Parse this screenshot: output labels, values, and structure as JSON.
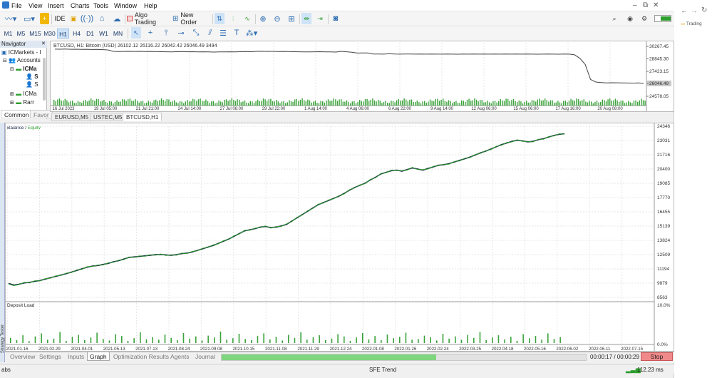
{
  "menu": [
    "File",
    "View",
    "Insert",
    "Charts",
    "Tools",
    "Window",
    "Help"
  ],
  "toolbar": {
    "ide_label": "IDE",
    "algo_label": "Algo Trading",
    "new_order_label": "New Order"
  },
  "timeframes": [
    "M1",
    "M5",
    "M15",
    "M30",
    "H1",
    "H4",
    "D1",
    "W1",
    "MN"
  ],
  "active_timeframe": "H1",
  "navigator": {
    "title": "Navigator",
    "broker": "ICMarkets - I",
    "accounts": "Accounts",
    "account1": "ICMa",
    "row_s1": "S",
    "row_s2": "S",
    "account2": "ICMa",
    "raw": "Rarr",
    "tabs": [
      "Common",
      "Favor"
    ]
  },
  "top_chart": {
    "info": "BTCUSD, H1:  Bitcoin (USD)  26102.12 26116.22 26042.42 26046.49  3494",
    "y_labels": [
      "30267.45",
      "28845.30",
      "27423.15",
      "26046.49",
      "24578.05"
    ],
    "x_labels": [
      "16 Jul 2023",
      "19 Jul 05:00",
      "21 Jul 21:00",
      "24 Jul 14:00",
      "27 Jul 06:00",
      "29 Jul 22:00",
      "1 Aug 14:00",
      "4 Aug 06:00",
      "6 Aug 22:00",
      "9 Aug 14:00",
      "12 Aug 06:00",
      "15 Aug 06:00",
      "17 Aug 16:00",
      "20 Aug 08:00"
    ],
    "price_series": [
      29950,
      29940,
      29960,
      29930,
      29945,
      29920,
      29935,
      29910,
      29920,
      29890,
      29860,
      29700,
      29680,
      29690,
      29700,
      29690,
      29700,
      29680,
      29690,
      29670,
      29660,
      29650,
      29640,
      29660,
      29670,
      29650,
      29660,
      29640,
      29650,
      29630,
      29620,
      29640,
      29630,
      29650,
      29640,
      29660,
      29670,
      29660,
      29700,
      29710,
      29690,
      29700,
      29680,
      29690,
      29670,
      29660,
      29650,
      29640,
      29630,
      29650,
      29660,
      29640,
      29630,
      29620,
      29700,
      29650,
      29600,
      29500,
      29520,
      29510,
      29400,
      29400,
      29380,
      29420,
      29390,
      29380,
      29400,
      29390,
      29380,
      29390,
      29380,
      29390,
      29380,
      29380,
      29390,
      29380,
      29370,
      29390,
      29380,
      29390,
      29380,
      29390,
      29380,
      29390,
      29380,
      29400,
      29380,
      29390,
      29380,
      29390,
      29380,
      29370,
      29380,
      29390,
      29380,
      29370,
      29390,
      29380,
      29300,
      28900,
      28200,
      26500,
      26200,
      26150,
      26100,
      26120,
      26110,
      26100,
      26090,
      26080,
      26100,
      26046
    ]
  },
  "chart_tabs": [
    "EURUSD,M5",
    "USTEC,M5",
    "BTCUSD,H1"
  ],
  "active_chart_tab": "BTCUSD,H1",
  "tester": {
    "legend_balance": "Balance",
    "legend_sep": " / ",
    "legend_equity": "Equity",
    "deposit_label": "Deposit Load",
    "y_labels": [
      "24346",
      "23031",
      "21716",
      "20400",
      "19085",
      "17770",
      "16455",
      "15139",
      "13824",
      "12509",
      "11194",
      "9879",
      "8563"
    ],
    "load_labels": [
      "10.0%",
      "0.0%"
    ],
    "x_labels": [
      "2021.01.16",
      "2021.02.29",
      "2021.04.01",
      "2021.05.13",
      "2021.07.13",
      "2021.08.24",
      "2021.09.08",
      "2021.10.15",
      "2021.11.08",
      "2021.11.29",
      "2021.12.24",
      "2022.01.08",
      "2022.01.26",
      "2022.02.24",
      "2022.03.25",
      "2022.04.18",
      "2022.05.16",
      "2022.06.02",
      "2022.06.11",
      "2022.07.15"
    ],
    "side_label": "Strategy Tester"
  },
  "chart_data": [
    {
      "type": "line",
      "title": "Balance / Equity",
      "ylim": [
        8563,
        24346
      ],
      "series": [
        {
          "name": "Balance",
          "color": "#1a2a4a",
          "values": [
            9850,
            9700,
            9780,
            9900,
            9950,
            10050,
            10120,
            10250,
            10380,
            10500,
            10620,
            10750,
            10900,
            11050,
            11200,
            11350,
            11450,
            11500,
            11600,
            11700,
            11850,
            11950,
            12100,
            12250,
            12300,
            12350,
            12400,
            12450,
            12500,
            12520,
            12480,
            12450,
            12500,
            12600,
            12650,
            12750,
            12900,
            13050,
            13200,
            13350,
            13550,
            13750,
            13950,
            14200,
            14450,
            14700,
            14800,
            14900,
            15050,
            15100,
            15000,
            15050,
            15150,
            15300,
            15600,
            15900,
            16200,
            16500,
            16800,
            17100,
            17300,
            17500,
            17700,
            17900,
            18150,
            18450,
            18700,
            18900,
            19100,
            19400,
            19650,
            19950,
            20100,
            20250,
            20300,
            20200,
            20350,
            20500,
            20400,
            20300,
            20450,
            20600,
            20750,
            20800,
            20900,
            21050,
            21200,
            21350,
            21500,
            21700,
            21900,
            22050,
            22250,
            22450,
            22650,
            22800,
            22950,
            23050,
            23000,
            22900,
            22950,
            23100,
            23200,
            23350,
            23500,
            23600,
            23650
          ]
        },
        {
          "name": "Equity",
          "color": "#2e9e2e",
          "values": [
            9800,
            9650,
            9750,
            9950,
            9900,
            10100,
            10080,
            10300,
            10330,
            10550,
            10580,
            10800,
            10850,
            11100,
            11150,
            11400,
            11420,
            11550,
            11550,
            11750,
            11800,
            12000,
            12050,
            12300,
            12250,
            12400,
            12350,
            12500,
            12450,
            12570,
            12430,
            12500,
            12450,
            12650,
            12600,
            12800,
            12850,
            13100,
            13150,
            13400,
            13500,
            13800,
            13900,
            14250,
            14400,
            14750,
            14750,
            14950,
            15000,
            15150,
            14950,
            15100,
            15100,
            15350,
            15550,
            15950,
            16150,
            16550,
            16750,
            17150,
            17250,
            17550,
            17650,
            17950,
            18100,
            18500,
            18650,
            18950,
            19050,
            19450,
            19600,
            20000,
            20050,
            20300,
            20250,
            20250,
            20300,
            20550,
            20350,
            20350,
            20400,
            20650,
            20700,
            20850,
            20850,
            21100,
            21150,
            21400,
            21450,
            21750,
            21850,
            22100,
            22200,
            22500,
            22600,
            22850,
            22900,
            23100,
            22950,
            22950,
            22900,
            23150,
            23150,
            23400,
            23450,
            23650,
            23600
          ]
        }
      ]
    },
    {
      "type": "bar",
      "title": "Deposit Load",
      "ylim": [
        0,
        10
      ],
      "values": [
        1.4,
        0.8,
        2.1,
        0.5,
        1.8,
        2.6,
        0.9,
        1.2,
        3.0,
        0.6,
        1.7,
        2.2,
        0.8,
        1.5,
        2.8,
        1.1,
        0.7,
        2.4,
        1.9,
        0.6,
        1.3,
        2.9,
        1.0,
        1.6,
        0.9,
        2.3,
        1.4,
        0.8,
        2.7,
        1.2,
        1.8,
        0.7,
        2.0,
        1.5,
        3.1,
        0.9,
        1.3,
        2.5,
        1.1,
        0.8,
        1.9,
        2.6,
        1.0,
        1.7,
        0.7,
        2.2,
        1.4,
        2.9,
        0.9,
        1.6,
        2.1,
        0.8,
        1.2,
        2.4,
        1.8,
        0.6,
        1.5,
        2.7,
        1.0,
        1.9,
        0.8,
        2.3,
        1.3,
        1.7,
        2.8,
        0.9,
        1.1,
        2.0,
        1.6,
        0.7,
        2.5,
        1.2,
        1.8,
        0.9,
        2.2,
        1.4,
        3.0,
        0.8,
        1.5,
        2.1,
        1.0,
        1.7,
        0.6,
        2.4,
        1.3,
        1.9,
        0.9,
        2.6,
        1.1,
        1.6
      ]
    }
  ],
  "bottom_tabs": [
    "Overview",
    "Settings",
    "Inputs",
    "Graph",
    "Optimization Results",
    "Agents",
    "Journal"
  ],
  "active_bottom_tab": "Graph",
  "progress": {
    "elapsed": "00:00:17 / 00:00:29",
    "stop_label": "Stop",
    "fraction": 0.59
  },
  "status": {
    "left": "abs",
    "center": "SFE Trend",
    "ping": "112.23 ms"
  },
  "side": {
    "tab": "Trading"
  }
}
